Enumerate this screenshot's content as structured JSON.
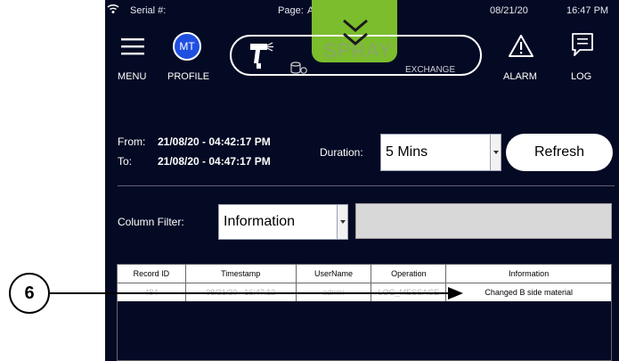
{
  "status_bar": {
    "serial_label": "Serial #:",
    "page_label": "Page:",
    "page_value": "Audit",
    "date": "08/21/20",
    "time": "16:47 PM"
  },
  "toolbar": {
    "menu_label": "MENU",
    "profile_label": "PROFILE",
    "profile_initials": "MT",
    "spray_label": "SPRAY",
    "exchange_label": "EXCHANGE",
    "alarm_label": "ALARM",
    "log_label": "LOG"
  },
  "range": {
    "from_label": "From:",
    "from_value": "21/08/20 - 04:42:17 PM",
    "to_label": "To:",
    "to_value": "21/08/20 - 04:47:17 PM",
    "duration_label": "Duration:",
    "duration_value": "5 Mins",
    "refresh_label": "Refresh"
  },
  "filter": {
    "label": "Column Filter:",
    "value": "Information",
    "text_value": ""
  },
  "table": {
    "columns": [
      "Record ID",
      "Timestamp",
      "UserName",
      "Operation",
      "Information"
    ],
    "rows": [
      [
        "484",
        "08/21/20 - 16:47:12",
        "admin",
        "LOG_MESSAGE",
        "Changed B side material"
      ]
    ]
  },
  "callout": {
    "number": "6"
  },
  "colors": {
    "screen_bg": "#040a24",
    "spray_tab": "#7bbd2d",
    "profile_badge": "#1f4fe0"
  }
}
